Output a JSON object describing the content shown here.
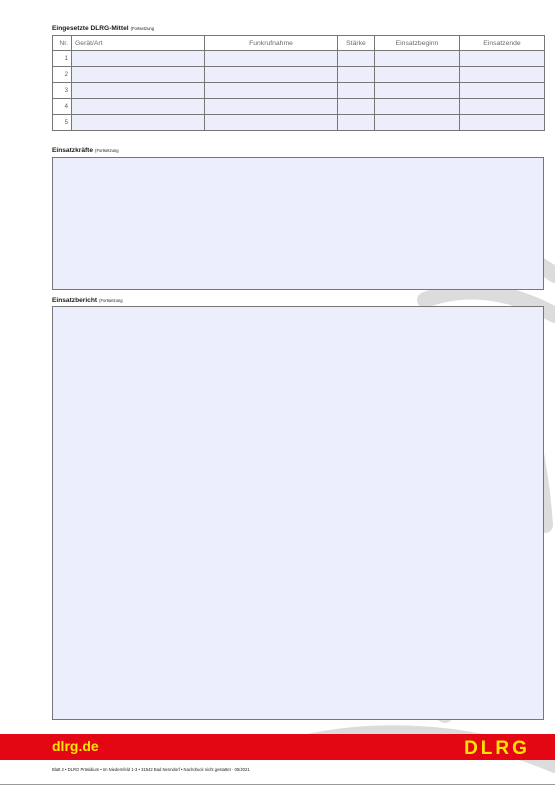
{
  "mittel": {
    "title": "Eingesetzte DLRG-Mittel",
    "subtitle": "(Fortsetzung",
    "columns": [
      "Nr.",
      "Gerät/Art",
      "Funkrufnahme",
      "Stärke",
      "Einsatzbeginn",
      "Einsatzende"
    ],
    "rows": [
      "1",
      "2",
      "3",
      "4",
      "5"
    ]
  },
  "kraefte": {
    "title": "Einsatzkräfte",
    "subtitle": "(Fortsetzung"
  },
  "bericht": {
    "title": "Einsatzbericht",
    "subtitle": "(Fortsetzung"
  },
  "footer": {
    "site": "dlrg.de",
    "logo": "DLRG",
    "note": "Blatt 2 • DLRG Präsidium • Im Niedernfeld 1-3 • 31542 Bad Nenndorf • Nachdruck nicht gestattet · 05/2021"
  },
  "colors": {
    "brand_red": "#e30613",
    "brand_yellow": "#ffe600",
    "field_fill": "#eceefb"
  }
}
